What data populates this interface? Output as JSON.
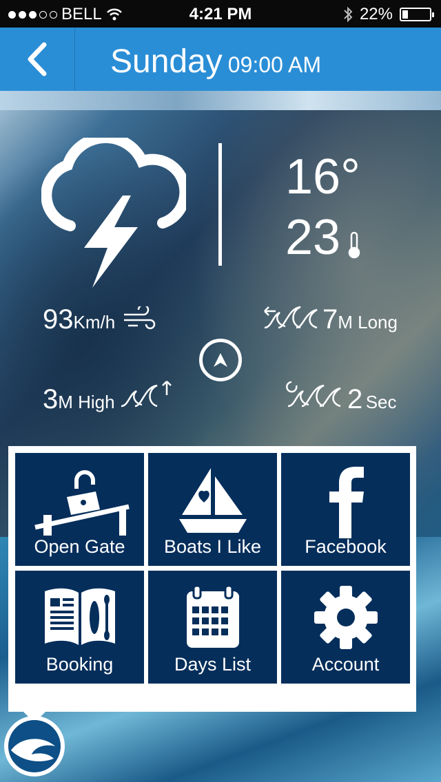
{
  "status_bar": {
    "carrier": "BELL",
    "time": "4:21 PM",
    "battery": "22%",
    "signal_bars_filled": 3,
    "signal_bars_total": 5
  },
  "header": {
    "day": "Sunday",
    "time": "09:00 AM"
  },
  "weather": {
    "temp_primary": "16°",
    "temp_secondary": "23",
    "wind_value": "93",
    "wind_unit": "Km/h",
    "swell_length_value": "7",
    "swell_length_unit": "M Long",
    "wave_height_value": "3",
    "wave_height_unit": "M High",
    "period_value": "2",
    "period_unit": "Sec"
  },
  "menu": {
    "tiles": [
      {
        "label": "Open Gate",
        "icon": "gate-unlock-icon"
      },
      {
        "label": "Boats I Like",
        "icon": "sailboat-heart-icon"
      },
      {
        "label": "Facebook",
        "icon": "facebook-icon"
      },
      {
        "label": "Booking",
        "icon": "book-icon"
      },
      {
        "label": "Days List",
        "icon": "calendar-icon"
      },
      {
        "label": "Account",
        "icon": "gear-icon"
      }
    ]
  },
  "colors": {
    "navbar": "#2a8ed6",
    "tile": "#052e5b",
    "statusbar": "#0a0a0a"
  }
}
